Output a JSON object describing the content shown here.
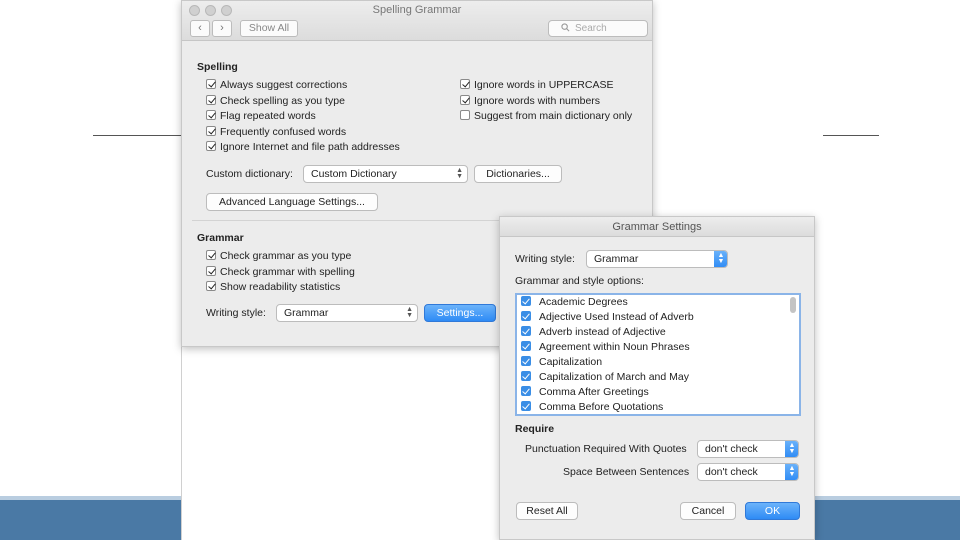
{
  "colors": {
    "accent": "#2e8bf5",
    "band": "#4a79a5",
    "window_bg": "#ececec"
  },
  "main_window": {
    "title": "Spelling Grammar",
    "toolbar": {
      "back_icon": "chevron-left-icon",
      "forward_icon": "chevron-right-icon",
      "show_all": "Show All",
      "search_placeholder": "Search"
    },
    "spelling": {
      "heading": "Spelling",
      "left_options": [
        {
          "label": "Always suggest corrections",
          "checked": true
        },
        {
          "label": "Check spelling as you type",
          "checked": true
        },
        {
          "label": "Flag repeated words",
          "checked": true
        },
        {
          "label": "Frequently confused words",
          "checked": true
        },
        {
          "label": "Ignore Internet and file path addresses",
          "checked": true
        }
      ],
      "right_options": [
        {
          "label": "Ignore words in UPPERCASE",
          "checked": true
        },
        {
          "label": "Ignore words with numbers",
          "checked": true
        },
        {
          "label": "Suggest from main dictionary only",
          "checked": false
        }
      ],
      "custom_dictionary_label": "Custom dictionary:",
      "custom_dictionary_value": "Custom Dictionary",
      "dictionaries_button": "Dictionaries...",
      "advanced_button": "Advanced Language Settings..."
    },
    "grammar": {
      "heading": "Grammar",
      "options": [
        {
          "label": "Check grammar as you type",
          "checked": true
        },
        {
          "label": "Check grammar with spelling",
          "checked": true
        },
        {
          "label": "Show readability statistics",
          "checked": true
        }
      ],
      "writing_style_label": "Writing style:",
      "writing_style_value": "Grammar",
      "settings_button": "Settings..."
    }
  },
  "grammar_settings": {
    "title": "Grammar Settings",
    "writing_style_label": "Writing style:",
    "writing_style_value": "Grammar",
    "options_label": "Grammar and style options:",
    "options": [
      {
        "label": "Academic Degrees",
        "checked": true
      },
      {
        "label": "Adjective Used Instead of Adverb",
        "checked": true
      },
      {
        "label": "Adverb instead of Adjective",
        "checked": true
      },
      {
        "label": "Agreement within Noun Phrases",
        "checked": true
      },
      {
        "label": "Capitalization",
        "checked": true
      },
      {
        "label": "Capitalization of March and May",
        "checked": true
      },
      {
        "label": "Comma After Greetings",
        "checked": true
      },
      {
        "label": "Comma Before Quotations",
        "checked": true
      }
    ],
    "require_heading": "Require",
    "punctuation_label": "Punctuation Required With Quotes",
    "punctuation_value": "don't check",
    "space_label": "Space Between Sentences",
    "space_value": "don't check",
    "reset_button": "Reset All",
    "cancel_button": "Cancel",
    "ok_button": "OK"
  }
}
